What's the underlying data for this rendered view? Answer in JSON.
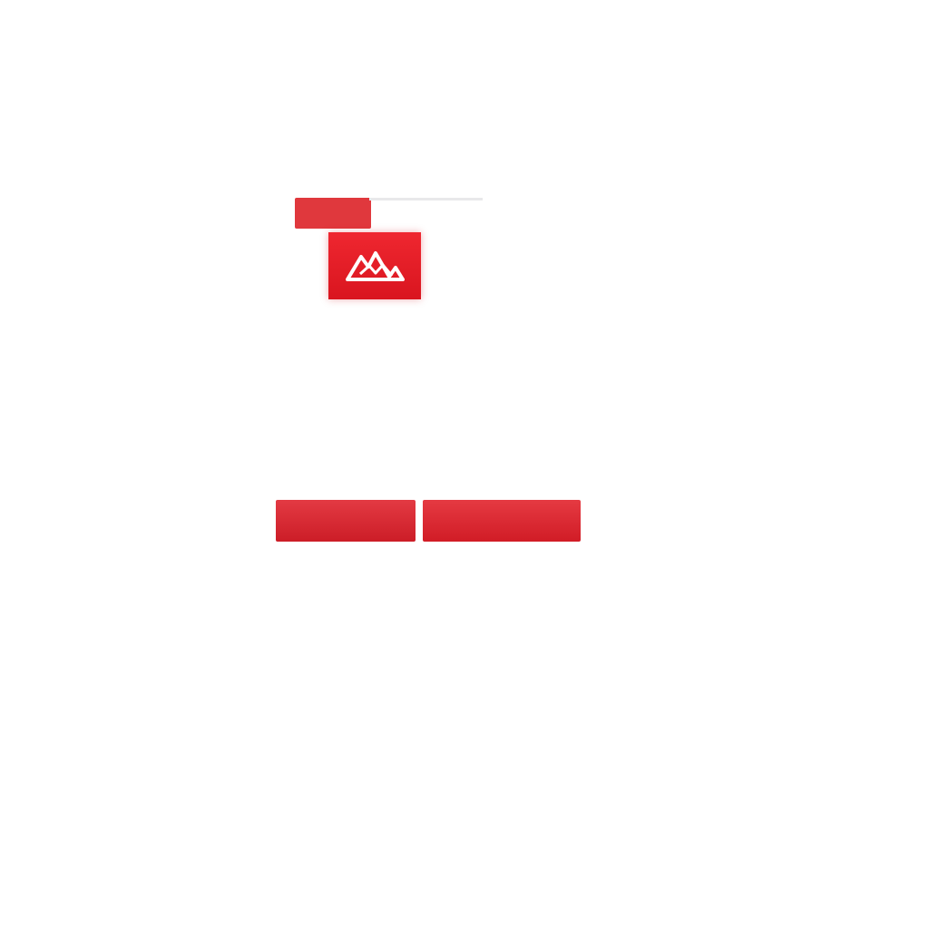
{
  "page": {
    "top_label": "",
    "title": "",
    "subtitle_lines": [
      "",
      ""
    ],
    "brand": {
      "logo_icon": "mountain-logo-icon",
      "logo_color": "#dd2228"
    },
    "meta": {
      "left": "",
      "right": ""
    },
    "paragraphs": [
      {
        "lines": [
          "",
          ""
        ]
      },
      {
        "lines": [
          "",
          ""
        ]
      }
    ],
    "actions": {
      "primary_label": "",
      "secondary_label": "",
      "button_color": "#d8242d"
    },
    "footer": {
      "link": "",
      "small": ""
    }
  }
}
